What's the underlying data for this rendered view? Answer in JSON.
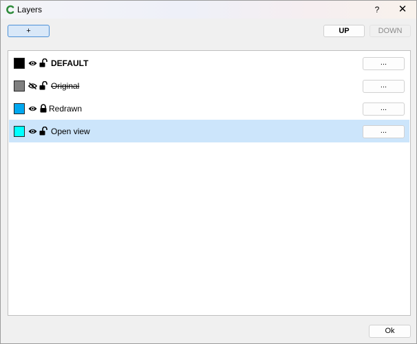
{
  "window": {
    "title": "Layers",
    "help_label": "?",
    "close_label": "✕",
    "app_icon": "app-logo-icon",
    "accent_color": "#2e8b3a"
  },
  "toolbar": {
    "add_label": "+",
    "up_label": "UP",
    "down_label": "DOWN"
  },
  "layers": [
    {
      "name": "DEFAULT",
      "color": "#000000",
      "visible": true,
      "locked": false,
      "bold": true,
      "strikethrough": false,
      "selected": false,
      "button_label": "..."
    },
    {
      "name": "Original",
      "color": "#808080",
      "visible": false,
      "locked": false,
      "bold": false,
      "strikethrough": true,
      "selected": false,
      "button_label": "..."
    },
    {
      "name": "Redrawn",
      "color": "#00a8f0",
      "visible": true,
      "locked": true,
      "bold": false,
      "strikethrough": false,
      "selected": false,
      "button_label": "..."
    },
    {
      "name": "Open view",
      "color": "#00ffff",
      "visible": true,
      "locked": false,
      "bold": false,
      "strikethrough": false,
      "selected": true,
      "button_label": "..."
    }
  ],
  "footer": {
    "ok_label": "Ok"
  },
  "icons": {
    "visible": "eye-icon",
    "hidden": "eye-slash-icon",
    "locked": "lock-closed-icon",
    "unlocked": "lock-open-icon"
  }
}
